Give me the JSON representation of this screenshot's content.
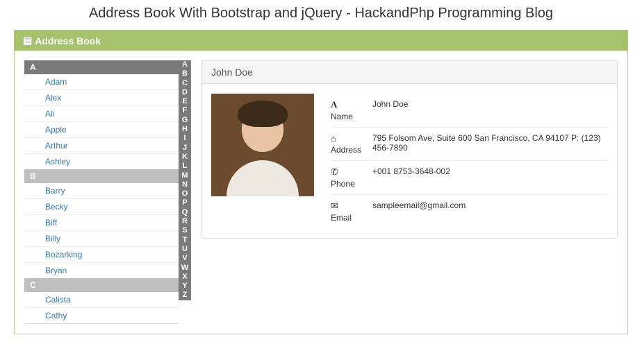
{
  "page_title": "Address Book With Bootstrap and jQuery - HackandPhp Programming Blog",
  "panel_title": "Address Book",
  "alpha_index": [
    "A",
    "B",
    "C",
    "D",
    "E",
    "F",
    "G",
    "H",
    "I",
    "J",
    "K",
    "L",
    "M",
    "N",
    "O",
    "P",
    "Q",
    "R",
    "S",
    "T",
    "U",
    "V",
    "W",
    "X",
    "Y",
    "Z"
  ],
  "sections": [
    {
      "letter": "A",
      "style": "dark",
      "items": [
        "Adam",
        "Alex",
        "Ali",
        "Apple",
        "Arthur",
        "Ashley"
      ]
    },
    {
      "letter": "B",
      "style": "light",
      "items": [
        "Barry",
        "Becky",
        "Biff",
        "Billy",
        "Bozarking",
        "Bryan"
      ]
    },
    {
      "letter": "C",
      "style": "light",
      "items": [
        "Calista",
        "Cathy"
      ]
    }
  ],
  "contact": {
    "display_name": "John Doe",
    "fields": {
      "name": {
        "icon": "A",
        "label": "Name",
        "value": "John Doe"
      },
      "address": {
        "icon": "⌂",
        "label": "Address",
        "value": "795 Folsom Ave, Suite 600 San Francisco, CA 94107 P: (123) 456-7890"
      },
      "phone": {
        "icon": "✆",
        "label": "Phone",
        "value": "+001 8753-3648-002"
      },
      "email": {
        "icon": "✉",
        "label": "Email",
        "value": "sampleemail@gmail.com"
      }
    }
  }
}
